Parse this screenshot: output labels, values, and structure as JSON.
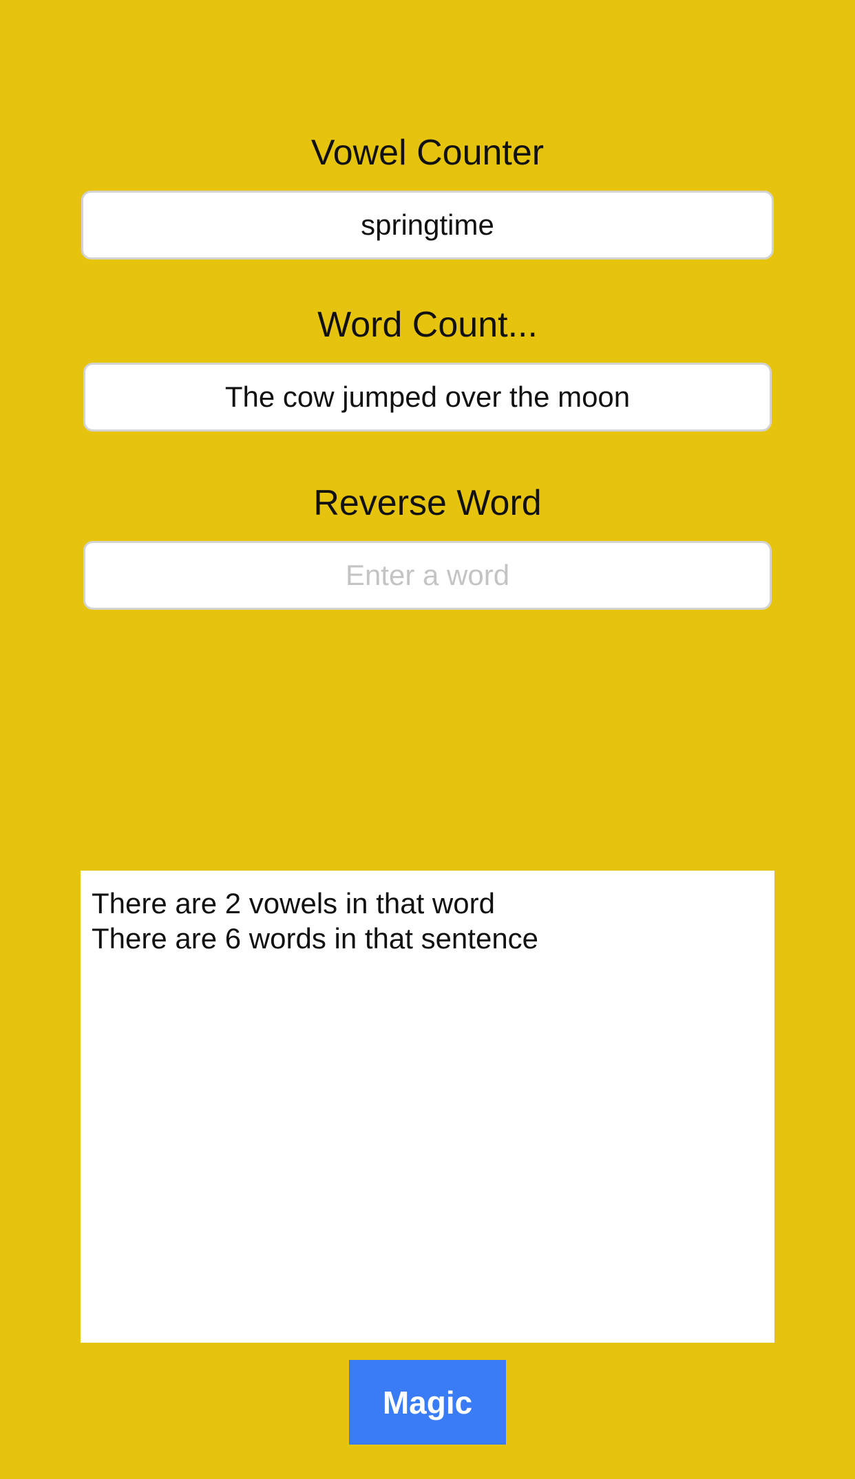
{
  "vowel_counter": {
    "label": "Vowel Counter",
    "value": "springtime",
    "placeholder": ""
  },
  "word_count": {
    "label": "Word Count...",
    "value": "The cow jumped over the moon",
    "placeholder": ""
  },
  "reverse_word": {
    "label": "Reverse Word",
    "value": "",
    "placeholder": "Enter a word"
  },
  "output": {
    "lines": [
      "There are 2 vowels in that word",
      "There are 6 words in that sentence"
    ]
  },
  "magic_button": {
    "label": "Magic"
  },
  "colors": {
    "background": "#E6C40D",
    "button": "#3A7CF6",
    "field_border": "#D3D3D3",
    "placeholder_text": "#C4C4C4"
  }
}
